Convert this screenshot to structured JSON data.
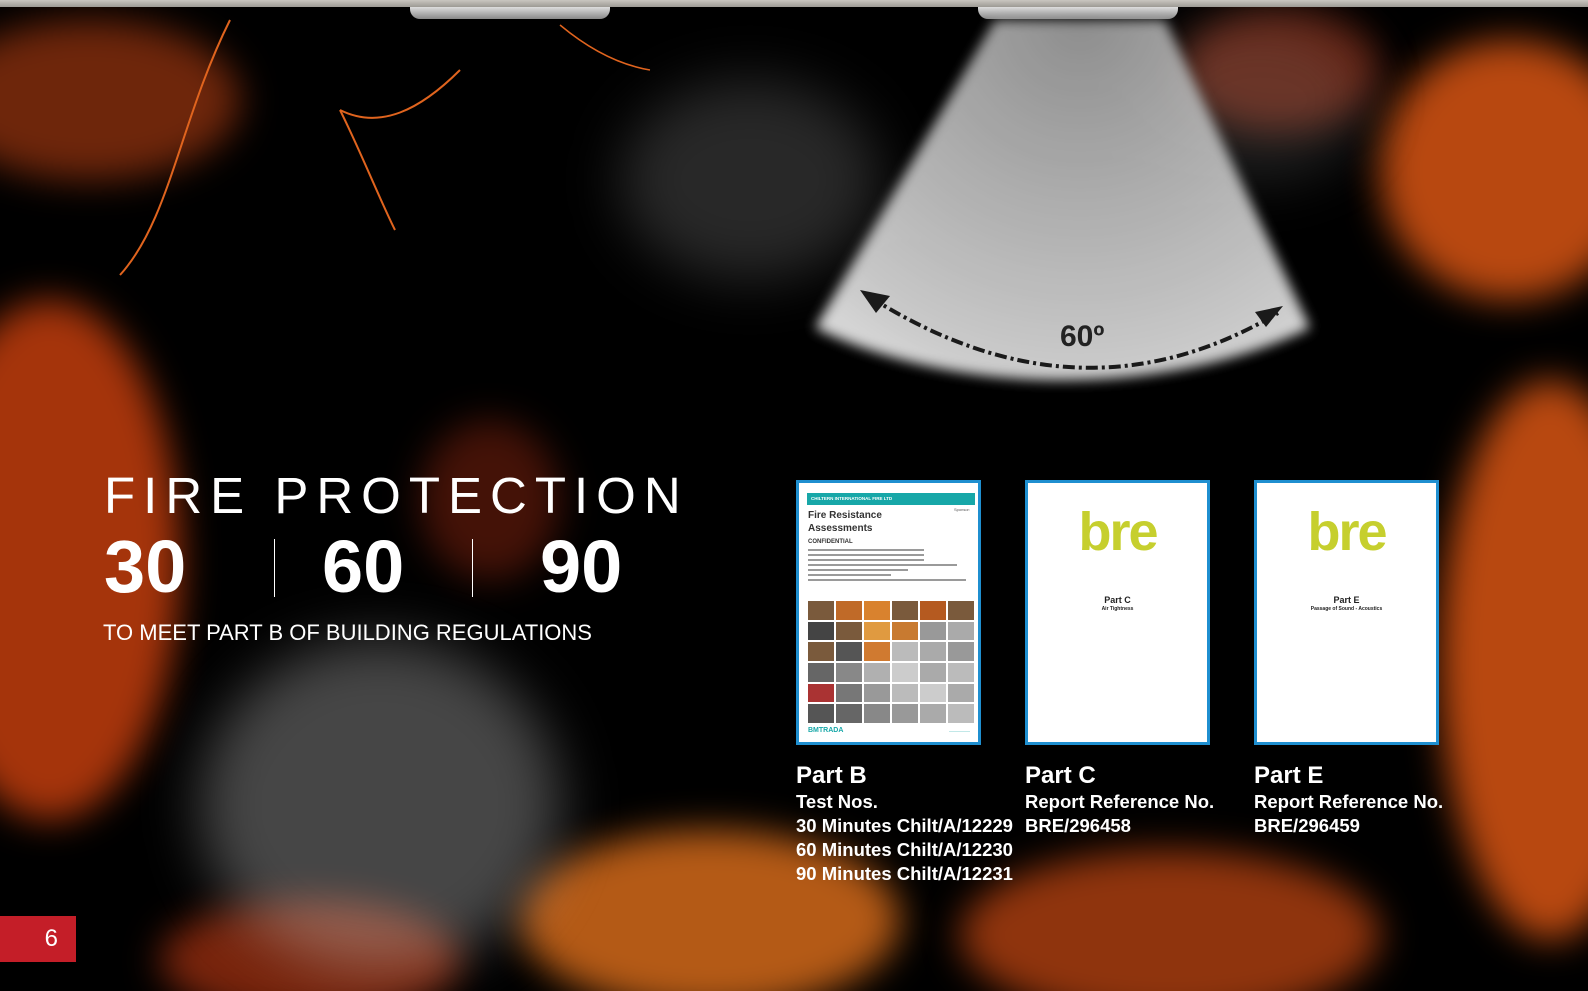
{
  "background": {
    "fire_color": "#e8541a",
    "smoke_color": "#bfbfbf",
    "base_color": "#000000"
  },
  "diagram": {
    "angle_label": "60º"
  },
  "headline": {
    "title": "FIRE PROTECTION",
    "ratings": [
      "30",
      "60",
      "90"
    ],
    "subtitle": "TO MEET PART B OF BUILDING REGULATIONS"
  },
  "documents": [
    {
      "type": "report-cover",
      "header": "CHILTERN INTERNATIONAL FIRE LTD",
      "title": "Fire Resistance Assessments",
      "confidential": "CONFIDENTIAL",
      "sponsor_label": "Sponsor:",
      "footer_logo": "BMTRADA",
      "caption_title": "Part B",
      "caption_lines": [
        "Test Nos.",
        "30 Minutes Chilt/A/12229",
        "60 Minutes Chilt/A/12230",
        "90 Minutes Chilt/A/12231"
      ]
    },
    {
      "type": "bre",
      "logo": "bre",
      "part": "Part C",
      "sub": "Air Tightness",
      "caption_title": "Part C",
      "caption_lines": [
        "Report Reference No.",
        "BRE/296458"
      ]
    },
    {
      "type": "bre",
      "logo": "bre",
      "part": "Part E",
      "sub": "Passage of Sound - Acoustics",
      "caption_title": "Part E",
      "caption_lines": [
        "Report Reference No.",
        "BRE/296459"
      ]
    }
  ],
  "page_number": "6",
  "colors": {
    "accent_red": "#c41e28",
    "card_border": "#1f8fd0",
    "bre_green": "#c6cf2e"
  }
}
